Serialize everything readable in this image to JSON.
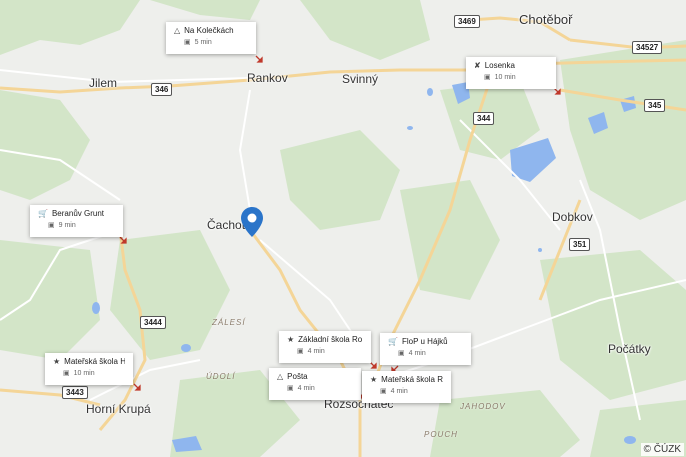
{
  "places": {
    "chotebor": "Chotěboř",
    "jilem": "Jilem",
    "rankov": "Rankov",
    "svinny": "Svinný",
    "cachotin": "Čachotín",
    "dobkov": "Dobkov",
    "pocatky": "Počátky",
    "horni_krupa": "Horní Krupá",
    "rozsochatec": "Rozsochatec"
  },
  "regions": {
    "zalesi": "ZÁLESÍ",
    "udoli": "ÚDOLÍ",
    "jahodov": "JAHODOV",
    "pouch": "POUCH"
  },
  "roads": {
    "r3469": "3469",
    "r34527": "34527",
    "r346": "346",
    "r345": "345",
    "r344": "344",
    "r351": "351",
    "r3444": "3444",
    "r3443": "3443"
  },
  "pois": [
    {
      "name": "Na Kolečkách",
      "time": "5 min",
      "icon": "playground-icon"
    },
    {
      "name": "Losenka",
      "time": "10 min",
      "icon": "restaurant-icon"
    },
    {
      "name": "Beranův Grunt",
      "time": "9 min",
      "icon": "shop-icon"
    },
    {
      "name": "Základní škola Ro...",
      "time": "4 min",
      "icon": "school-icon"
    },
    {
      "name": "FloP u Hájků",
      "time": "4 min",
      "icon": "shop-icon"
    },
    {
      "name": "Mateřská škola H...",
      "time": "10 min",
      "icon": "school-icon"
    },
    {
      "name": "Pošta",
      "time": "4 min",
      "icon": "playground-icon"
    },
    {
      "name": "Mateřská škola R...",
      "time": "4 min",
      "icon": "school-icon"
    }
  ],
  "copyright": "© ČÚZK",
  "colors": {
    "water": "#8fb6ee",
    "forest": "#cfe3c4",
    "road_major": "#f6d99a",
    "pin": "#2a74c9"
  }
}
